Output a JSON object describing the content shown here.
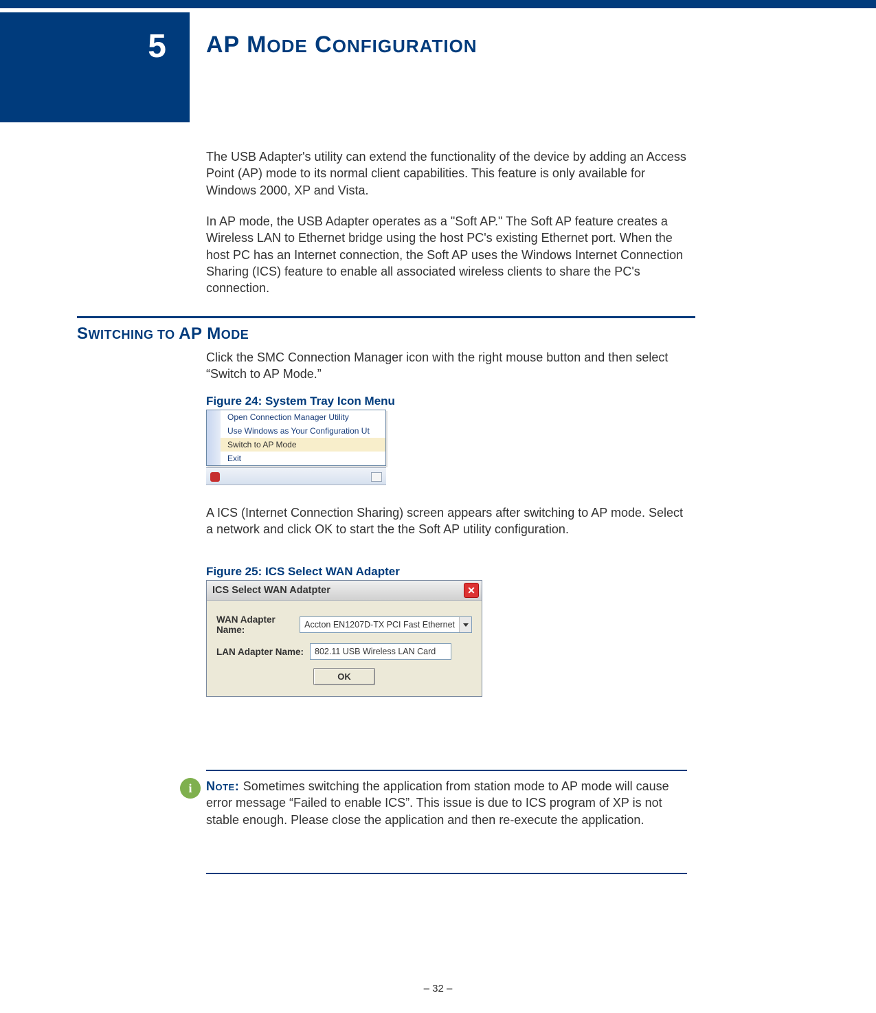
{
  "chapter": {
    "number": "5",
    "title_main": "AP M",
    "title_sub1": "ODE",
    "title_main2": " C",
    "title_sub2": "ONFIGURATION"
  },
  "paragraphs": {
    "p1": "The USB Adapter's utility can extend the functionality of the device by adding an Access Point (AP) mode to its normal client capabilities. This feature is only available for Windows 2000, XP and Vista.",
    "p2": "In AP mode, the USB Adapter operates as a \"Soft AP.\" The Soft AP feature creates a Wireless LAN to Ethernet bridge using the host PC's existing Ethernet port. When the host PC has an Internet connection, the Soft AP uses the Windows Internet Connection Sharing (ICS) feature to enable all associated wireless clients to share the PC's connection.",
    "p3": "Click the SMC Connection Manager icon with the right mouse button and then select “Switch to AP Mode.”",
    "p4": "A ICS (Internet Connection Sharing) screen appears after switching to AP mode. Select a network and click OK to start the the Soft AP utility configuration."
  },
  "section": {
    "head_big1": "S",
    "head_small1": "WITCHING",
    "head_mid": " TO ",
    "head_big2": "AP M",
    "head_small2": "ODE"
  },
  "figures": {
    "f24_caption": "Figure 24:  System Tray Icon Menu",
    "f25_caption": "Figure 25:  ICS Select WAN Adapter"
  },
  "tray_menu": {
    "items": [
      "Open Connection Manager Utility",
      "Use Windows as Your Configuration Ut",
      "Switch to AP Mode",
      "Exit"
    ],
    "selected_index": 2
  },
  "ics_dialog": {
    "title": "ICS Select WAN Adatpter",
    "wan_label": "WAN Adapter Name:",
    "wan_value": "Accton EN1207D-TX PCI Fast Ethernet",
    "lan_label": "LAN Adapter Name:",
    "lan_value": "802.11 USB Wireless LAN Card",
    "ok": "OK"
  },
  "note": {
    "icon": "i",
    "label": "Note: ",
    "text": "Sometimes switching the application from station mode to AP mode will cause error message “Failed to enable ICS”. This issue is due to ICS program of XP is not stable enough. Please close the application and then re-execute the application."
  },
  "page": {
    "num": "–  32  –"
  }
}
